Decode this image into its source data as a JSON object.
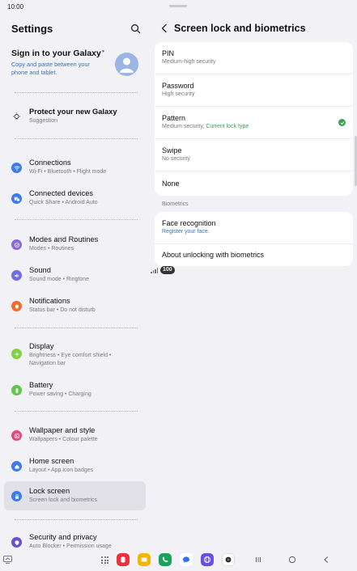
{
  "status": {
    "time": "10:00",
    "battery": "100"
  },
  "settings": {
    "title": "Settings",
    "account": {
      "title": "Sign in to your Galaxy",
      "subtitle": "Copy and paste between your phone and tablet."
    },
    "items": [
      {
        "id": "protect",
        "label": "Protect your new Galaxy",
        "sub": "Suggestion",
        "icon": "lightbulb-icon",
        "color": "#ffffff"
      },
      {
        "id": "connections",
        "label": "Connections",
        "sub": "Wi-Fi • Bluetooth • Flight mode",
        "icon": "wifi-icon",
        "color": "#3b7bea"
      },
      {
        "id": "connected-devices",
        "label": "Connected devices",
        "sub": "Quick Share • Android Auto",
        "icon": "devices-icon",
        "color": "#3b7bea"
      },
      {
        "id": "modes",
        "label": "Modes and Routines",
        "sub": "Modes • Routines",
        "icon": "modes-icon",
        "color": "#8a67e0"
      },
      {
        "id": "sound",
        "label": "Sound",
        "sub": "Sound mode • Ringtone",
        "icon": "speaker-icon",
        "color": "#6f6ce8"
      },
      {
        "id": "notifications",
        "label": "Notifications",
        "sub": "Status bar • Do not disturb",
        "icon": "bell-icon",
        "color": "#ef6a2b"
      },
      {
        "id": "display",
        "label": "Display",
        "sub": "Brightness • Eye comfort shield • Navigation bar",
        "icon": "sun-icon",
        "color": "#7ed33f"
      },
      {
        "id": "battery",
        "label": "Battery",
        "sub": "Power saving • Charging",
        "icon": "battery-icon",
        "color": "#5fc84a"
      },
      {
        "id": "wallpaper",
        "label": "Wallpaper and style",
        "sub": "Wallpapers • Colour palette",
        "icon": "palette-icon",
        "color": "#e8467e"
      },
      {
        "id": "home",
        "label": "Home screen",
        "sub": "Layout • App icon badges",
        "icon": "home-icon",
        "color": "#3b7bea"
      },
      {
        "id": "lock",
        "label": "Lock screen",
        "sub": "Screen lock and biometrics",
        "icon": "lock-icon",
        "color": "#3b7bea"
      },
      {
        "id": "security",
        "label": "Security and privacy",
        "sub": "Auto Blocker • Permission usage",
        "icon": "shield-icon",
        "color": "#6a4fd0"
      }
    ]
  },
  "detail": {
    "title": "Screen lock and biometrics",
    "lock_types": [
      {
        "label": "PIN",
        "sub": "Medium-high security"
      },
      {
        "label": "Password",
        "sub": "High security"
      },
      {
        "label": "Pattern",
        "sub": "Medium security,",
        "sub_extra": "Current lock type"
      },
      {
        "label": "Swipe",
        "sub": "No security"
      },
      {
        "label": "None"
      }
    ],
    "biometrics_label": "Biometrics",
    "biometrics": [
      {
        "label": "Face recognition",
        "sub": "Register your face."
      },
      {
        "label": "About unlocking with biometrics"
      }
    ]
  },
  "dock": [
    {
      "name": "dock-app-red",
      "color": "#e8333a"
    },
    {
      "name": "dock-app-yellow",
      "color": "#f5b400"
    },
    {
      "name": "dock-app-phone",
      "color": "#19a35a"
    },
    {
      "name": "dock-app-messages",
      "color": "#ffffff"
    },
    {
      "name": "dock-app-internet",
      "color": "#6b4fe0"
    },
    {
      "name": "dock-app-camera",
      "color": "#ffffff"
    }
  ]
}
